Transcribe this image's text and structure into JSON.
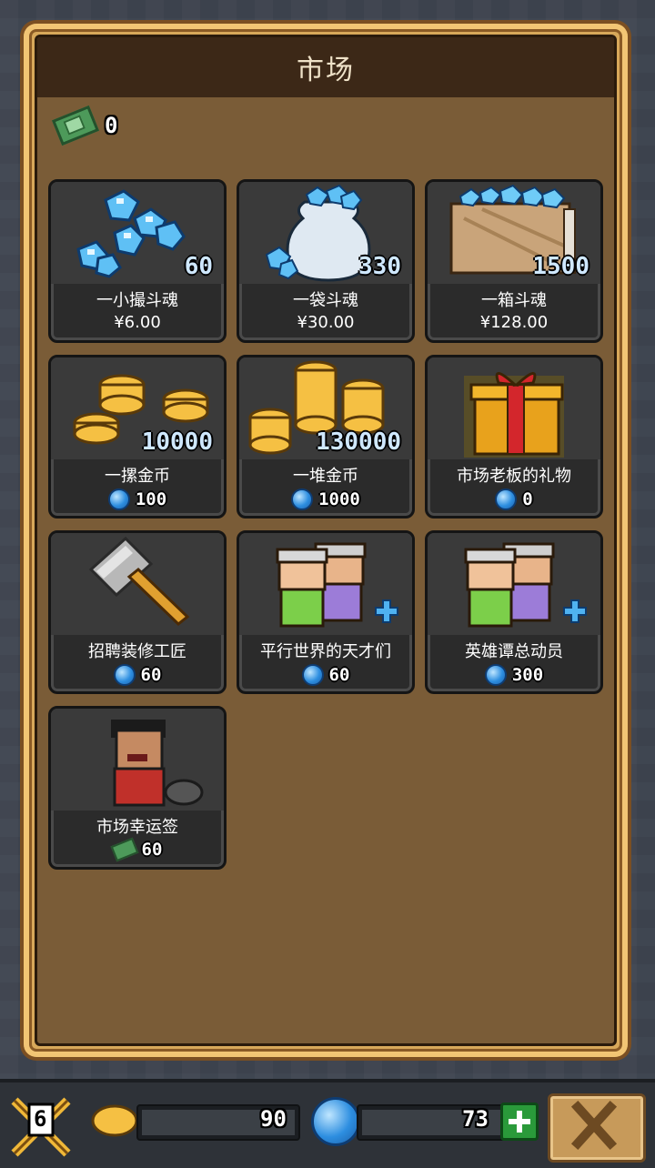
{
  "title": "市场",
  "wallet": {
    "bills": "0"
  },
  "items": [
    {
      "name": "一小撮斗魂",
      "amount": "60",
      "price": "¥6.00",
      "currency": "cny",
      "icon": "soul-gems-small-icon"
    },
    {
      "name": "一袋斗魂",
      "amount": "330",
      "price": "¥30.00",
      "currency": "cny",
      "icon": "soul-gems-bag-icon"
    },
    {
      "name": "一箱斗魂",
      "amount": "1500",
      "price": "¥128.00",
      "currency": "cny",
      "icon": "soul-gems-box-icon"
    },
    {
      "name": "一摞金币",
      "amount": "10000",
      "price": "100",
      "currency": "gem",
      "icon": "gold-coins-stack-icon"
    },
    {
      "name": "一堆金币",
      "amount": "130000",
      "price": "1000",
      "currency": "gem",
      "icon": "gold-coins-pile-icon"
    },
    {
      "name": "市场老板的礼物",
      "amount": "",
      "price": "0",
      "currency": "gem",
      "icon": "gift-box-icon"
    },
    {
      "name": "招聘装修工匠",
      "amount": "",
      "price": "60",
      "currency": "gem",
      "icon": "hammer-icon"
    },
    {
      "name": "平行世界的天才们",
      "amount": "",
      "price": "60",
      "currency": "gem",
      "icon": "scientists-icon"
    },
    {
      "name": "英雄谭总动员",
      "amount": "",
      "price": "300",
      "currency": "gem",
      "icon": "heroes-icon"
    },
    {
      "name": "市场幸运签",
      "amount": "",
      "price": "60",
      "currency": "bill",
      "icon": "lucky-character-icon"
    }
  ],
  "footer": {
    "level": "6",
    "coins": "90",
    "gems": "73"
  },
  "colors": {
    "gem": "#2d8ee0",
    "bill": "#4d9a5a",
    "gold": "#f5c043",
    "panel": "#7a5c37"
  }
}
